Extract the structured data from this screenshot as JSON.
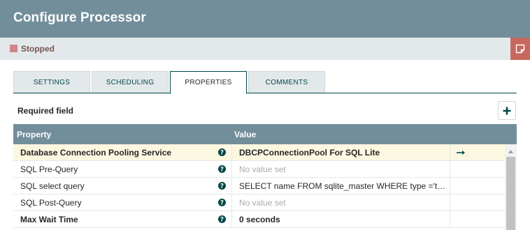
{
  "dialog": {
    "title": "Configure Processor"
  },
  "status": {
    "label": "Stopped",
    "color": "#d18686"
  },
  "tabs": [
    {
      "label": "SETTINGS",
      "active": false
    },
    {
      "label": "SCHEDULING",
      "active": false
    },
    {
      "label": "PROPERTIES",
      "active": true
    },
    {
      "label": "COMMENTS",
      "active": false
    }
  ],
  "properties_panel": {
    "required_field_label": "Required field",
    "columns": {
      "property": "Property",
      "value": "Value"
    },
    "rows": [
      {
        "property": "Database Connection Pooling Service",
        "value": "DBCPConnectionPool For SQL Lite",
        "required": true,
        "selected": true,
        "action": "go-to-arrow-icon"
      },
      {
        "property": "SQL Pre-Query",
        "value": "No value set",
        "required": false,
        "selected": false
      },
      {
        "property": "SQL select query",
        "value": "SELECT name FROM sqlite_master WHERE type ='table...",
        "required": false,
        "selected": false
      },
      {
        "property": "SQL Post-Query",
        "value": "No value set",
        "required": false,
        "selected": false
      },
      {
        "property": "Max Wait Time",
        "value": "0 seconds",
        "required": true,
        "selected": false
      }
    ]
  },
  "colors": {
    "header_bg": "#728e9b",
    "accent_dark": "#004849",
    "status_bar_bg": "#e3e8eb",
    "note_button_bg": "#c7685e",
    "selected_row_bg": "#fcf7e1"
  }
}
